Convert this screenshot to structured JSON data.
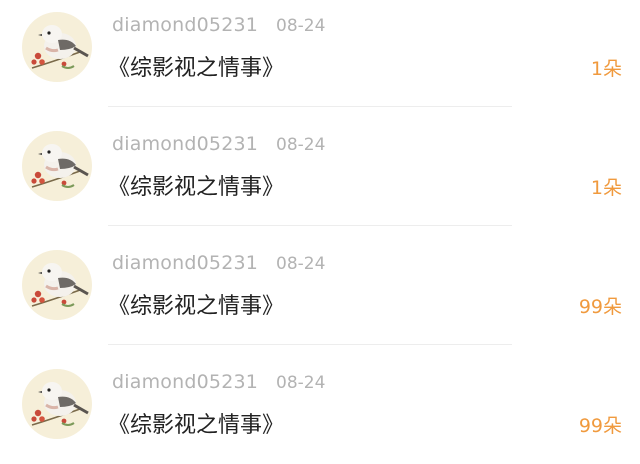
{
  "colors": {
    "username": "#b3b3b3",
    "title": "#222222",
    "gift": "#f09a3e",
    "avatar_bg": "#f6efd9"
  },
  "entries": [
    {
      "avatar_icon": "bird-avatar-icon",
      "username": "diamond05231",
      "date": "08-24",
      "title": "《综影视之情事》",
      "gift": "1朵"
    },
    {
      "avatar_icon": "bird-avatar-icon",
      "username": "diamond05231",
      "date": "08-24",
      "title": "《综影视之情事》",
      "gift": "1朵"
    },
    {
      "avatar_icon": "bird-avatar-icon",
      "username": "diamond05231",
      "date": "08-24",
      "title": "《综影视之情事》",
      "gift": "99朵"
    },
    {
      "avatar_icon": "bird-avatar-icon",
      "username": "diamond05231",
      "date": "08-24",
      "title": "《综影视之情事》",
      "gift": "99朵"
    }
  ]
}
